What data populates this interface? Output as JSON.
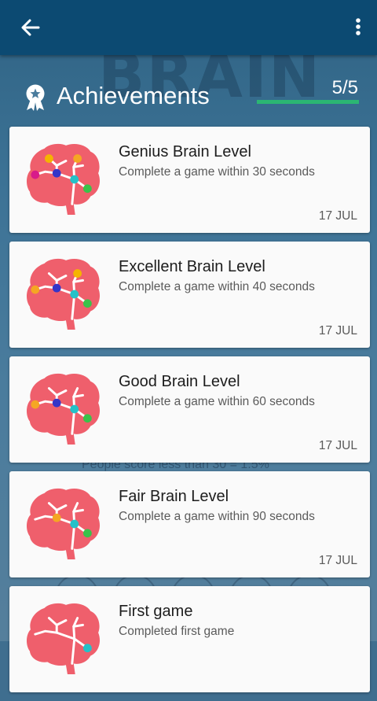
{
  "app_bar": {
    "back_icon": "arrow-left-icon",
    "menu_icon": "more-vertical-icon",
    "color": "#0c4a72"
  },
  "header": {
    "icon": "award-ribbon-icon",
    "title": "Achievements",
    "count": "5/5",
    "progress_fraction": 1.0,
    "progress_color": "#2bb673"
  },
  "background_text": {
    "logo": "BRAIN",
    "stat": "People score less than 30 = 1.5%"
  },
  "achievements": [
    {
      "title": "Genius Brain Level",
      "description": "Complete a game within 30 seconds",
      "date": "17 JUL",
      "icon": "brain-icon",
      "nodes": [
        "#f5b400",
        "#f5a623",
        "#d81b8a",
        "#3535c8",
        "#25c1c8",
        "#3ac24a"
      ]
    },
    {
      "title": "Excellent Brain Level",
      "description": "Complete a game within 40 seconds",
      "date": "17 JUL",
      "icon": "brain-icon",
      "nodes": [
        "#f5b400",
        "#f5a623",
        "#3535c8",
        "#25c1c8",
        "#3ac24a"
      ]
    },
    {
      "title": "Good Brain Level",
      "description": "Complete a game within 60 seconds",
      "date": "17 JUL",
      "icon": "brain-icon",
      "nodes": [
        "#f5a623",
        "#3535c8",
        "#25c1c8",
        "#3ac24a"
      ]
    },
    {
      "title": "Fair Brain Level",
      "description": "Complete a game within 90 seconds",
      "date": "17 JUL",
      "icon": "brain-icon",
      "nodes": [
        "#f5a623",
        "#25c1c8",
        "#3ac24a"
      ]
    },
    {
      "title": "First game",
      "description": "Completed first game",
      "date": "",
      "icon": "brain-icon",
      "nodes": [
        "#25c1c8"
      ]
    }
  ],
  "colors": {
    "brain": "#ef5f6c",
    "card_bg": "#fafafa"
  }
}
